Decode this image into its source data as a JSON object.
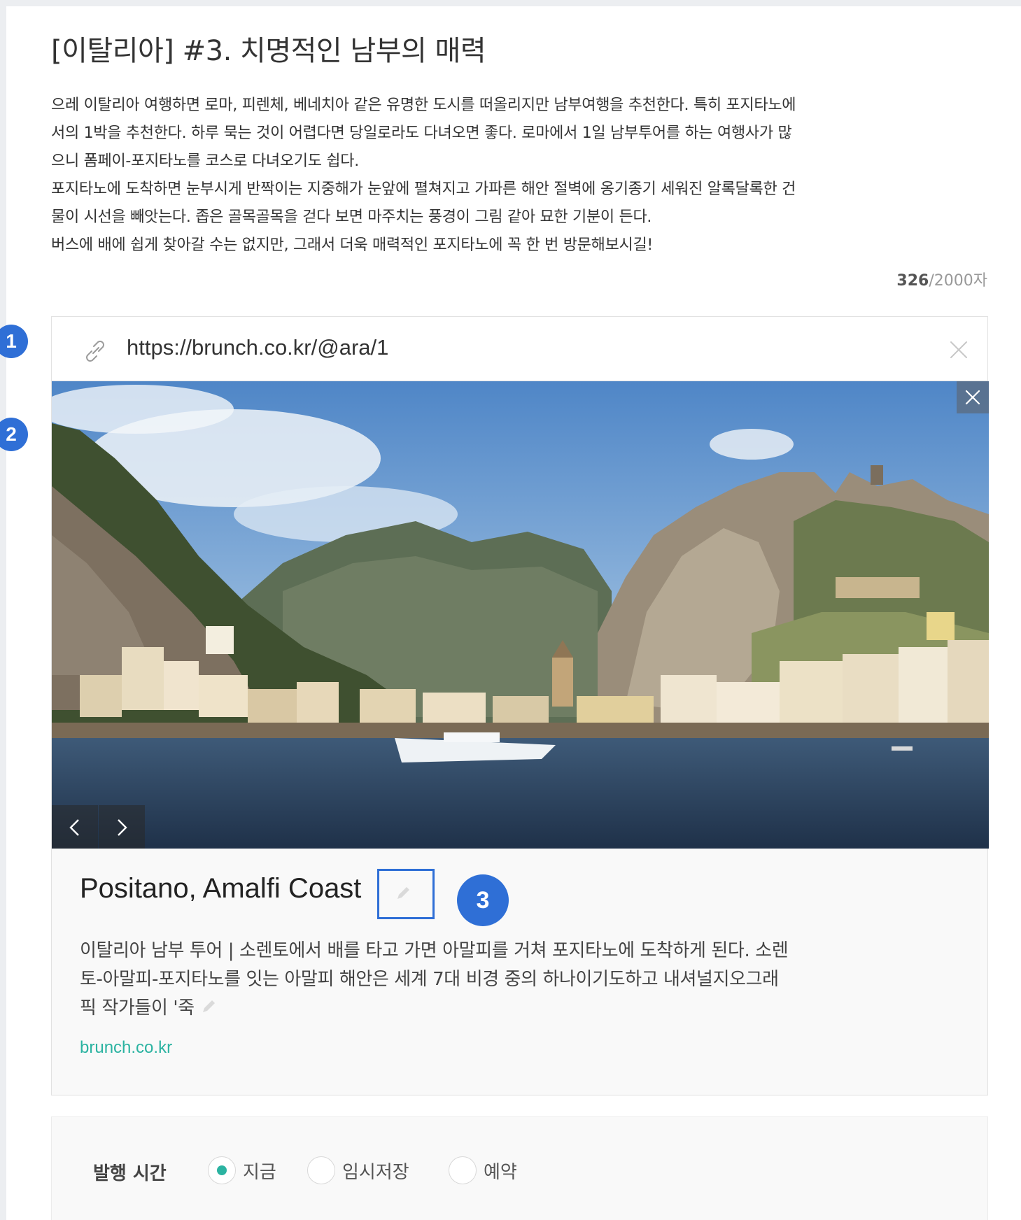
{
  "post": {
    "title": "[이탈리아] #3. 치명적인 남부의 매력",
    "body_lines": [
      "으레 이탈리아 여행하면 로마, 피렌체, 베네치아 같은 유명한 도시를 떠올리지만 남부여행을 추천한다. 특히 포지타노에",
      "서의 1박을 추천한다. 하루 묵는 것이 어렵다면 당일로라도 다녀오면 좋다. 로마에서 1일 남부투어를 하는 여행사가 많",
      "으니 폼페이-포지타노를 코스로 다녀오기도 쉽다.",
      "포지타노에 도착하면 눈부시게 반짝이는 지중해가 눈앞에 펼쳐지고 가파른 해안 절벽에 옹기종기 세워진 알록달록한 건",
      "물이 시선을 빼앗는다. 좁은 골목골목을 걷다 보면 마주치는 풍경이 그림 같아 묘한 기분이 든다.",
      "버스에 배에 쉽게 찾아갈 수는 없지만, 그래서 더욱 매력적인 포지타노에 꼭 한 번 방문해보시길!"
    ],
    "char_count": "326",
    "char_limit": "/2000자"
  },
  "link_card": {
    "url": "https://brunch.co.kr/@ara/1",
    "title": "Positano, Amalfi Coast",
    "description_lines": [
      "이탈리아 남부 투어 | 소렌토에서 배를 타고 가면 아말피를 거쳐 포지타노에 도착하게 된다. 소렌",
      "토-아말피-포지타노를 잇는 아말피 해안은 세계 7대 비경 중의 하나이기도하고 내셔널지오그래",
      "픽 작가들이 '죽"
    ],
    "domain": "brunch.co.kr",
    "icons": {
      "link": "link-icon",
      "close": "close-icon",
      "edit": "pencil-icon",
      "prev": "chevron-left-icon",
      "next": "chevron-right-icon"
    }
  },
  "publish": {
    "label": "발행 시간",
    "options": [
      {
        "label": "지금",
        "selected": true
      },
      {
        "label": "임시저장",
        "selected": false
      },
      {
        "label": "예약",
        "selected": false
      }
    ]
  },
  "markers": [
    "1",
    "2",
    "3"
  ],
  "colors": {
    "accent": "#2bb3a1",
    "marker": "#2f6fd6",
    "border": "#e2e2e2",
    "panel_bg": "#f9f9f9"
  }
}
